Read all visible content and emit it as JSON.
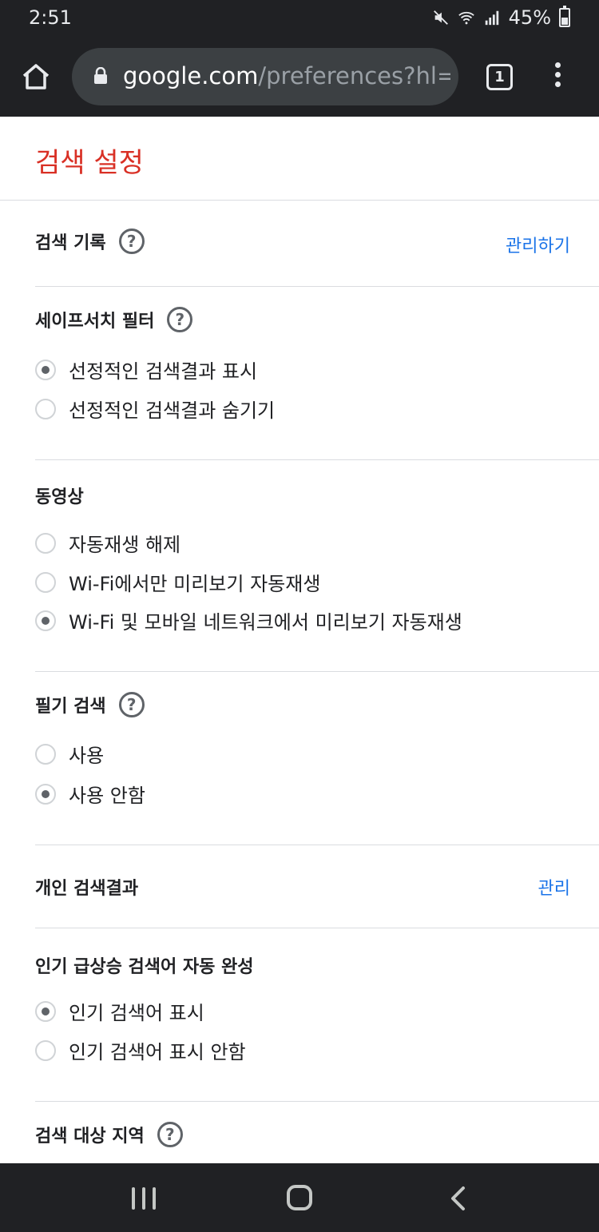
{
  "status_bar": {
    "time": "2:51",
    "battery": "45%",
    "icons": [
      "mute-icon",
      "wifi-icon",
      "signal-icon",
      "battery-icon"
    ]
  },
  "browser": {
    "url_domain": "google.com",
    "url_path": "/preferences?hl=",
    "tab_count": "1",
    "colors": {
      "toolbar": "#202124",
      "url_bar": "#3c4043"
    }
  },
  "page": {
    "title": "검색 설정",
    "title_color": "#d93025",
    "link_color": "#1a73e8",
    "sections": {
      "history": {
        "label": "검색 기록",
        "action": "관리하기"
      },
      "safesearch": {
        "label": "세이프서치 필터",
        "options": [
          {
            "label": "선정적인 검색결과 표시",
            "checked": true
          },
          {
            "label": "선정적인 검색결과 숨기기",
            "checked": false
          }
        ]
      },
      "video": {
        "label": "동영상",
        "options": [
          {
            "label": "자동재생 해제",
            "checked": false
          },
          {
            "label": "Wi-Fi에서만 미리보기 자동재생",
            "checked": false
          },
          {
            "label": "Wi-Fi 및 모바일 네트워크에서 미리보기 자동재생",
            "checked": true
          }
        ]
      },
      "handwriting": {
        "label": "필기 검색",
        "options": [
          {
            "label": "사용",
            "checked": false
          },
          {
            "label": "사용 안함",
            "checked": true
          }
        ]
      },
      "personal": {
        "label": "개인 검색결과",
        "action": "관리"
      },
      "trending": {
        "label": "인기 급상승 검색어 자동 완성",
        "options": [
          {
            "label": "인기 검색어 표시",
            "checked": true
          },
          {
            "label": "인기 검색어 표시 안함",
            "checked": false
          }
        ]
      },
      "region": {
        "label": "검색 대상 지역"
      }
    }
  }
}
